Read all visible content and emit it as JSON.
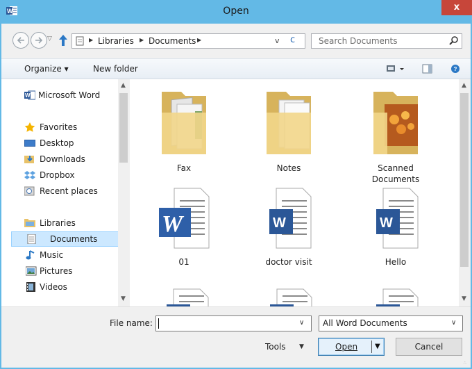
{
  "window": {
    "title": "Open",
    "close_label": "x",
    "accent": "#63b9e6"
  },
  "address_bar": {
    "crumbs": [
      "Libraries",
      "Documents"
    ],
    "dropdown_glyph": "v",
    "refresh_glyph": "c"
  },
  "search": {
    "placeholder": "Search Documents"
  },
  "toolbar": {
    "organize_label": "Organize ▾",
    "new_folder_label": "New folder"
  },
  "nav": {
    "items": [
      {
        "label": "Microsoft Word",
        "icon": "word-icon"
      },
      {
        "label": "Favorites",
        "icon": "star-icon"
      },
      {
        "label": "Desktop",
        "icon": "desktop-icon"
      },
      {
        "label": "Downloads",
        "icon": "downloads-icon"
      },
      {
        "label": "Dropbox",
        "icon": "dropbox-icon"
      },
      {
        "label": "Recent places",
        "icon": "recent-places-icon"
      },
      {
        "label": "Libraries",
        "icon": "libraries-icon"
      },
      {
        "label": "Documents",
        "icon": "document-icon",
        "selected": true
      },
      {
        "label": "Music",
        "icon": "music-icon"
      },
      {
        "label": "Pictures",
        "icon": "pictures-icon"
      },
      {
        "label": "Videos",
        "icon": "videos-icon"
      }
    ]
  },
  "files": {
    "items": [
      {
        "name": "Fax",
        "type": "folder"
      },
      {
        "name": "Notes",
        "type": "folder"
      },
      {
        "name": "Scanned Documents",
        "type": "folder"
      },
      {
        "name": "01",
        "type": "word-doc"
      },
      {
        "name": "doctor visit",
        "type": "word-doc"
      },
      {
        "name": "Hello",
        "type": "word-doc"
      }
    ]
  },
  "bottom": {
    "file_name_label": "File name:",
    "file_name_value": "",
    "filter_value": "All Word Documents",
    "tools_label": "Tools",
    "open_label": "Open",
    "cancel_label": "Cancel"
  }
}
